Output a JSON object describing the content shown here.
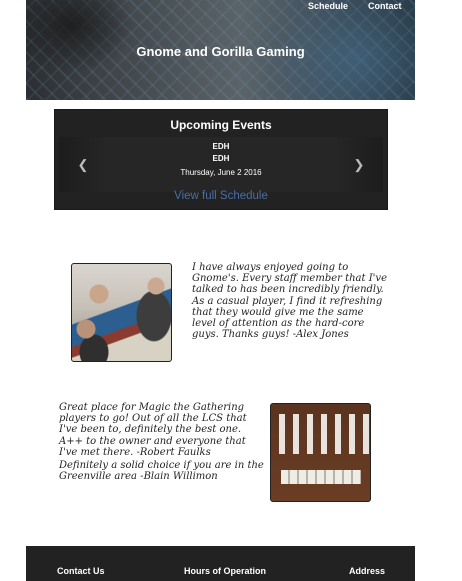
{
  "nav": {
    "schedule_label": "Schedule",
    "contact_label": "Contact"
  },
  "header": {
    "title": "Gnome and Gorilla Gaming"
  },
  "events": {
    "title": "Upcoming Events",
    "items": [
      "EDH",
      "EDH"
    ],
    "date": "Thursday, June 2 2016",
    "prev_icon": "chevron-left-icon",
    "next_icon": "chevron-right-icon",
    "view_schedule_label": "View full Schedule"
  },
  "testimonials": [
    {
      "text": "I have always enjoyed going to Gnome's. Every staff member that I've talked to has been incredibly friendly. As a casual player, I find it refreshing that they would give me the same level of attention as the hard-core guys. Thanks guys! -Alex Jones"
    },
    {
      "text": "Great place for Magic the Gathering players to go! Out of all the LCS that I've been to, definitely the best one. A++ to the owner and everyone that I've met there. -Robert Faulks"
    },
    {
      "text": "Definitely a solid choice if you are in the Greenville area -Blain Willimon"
    }
  ],
  "footer": {
    "contact_heading": "Contact Us",
    "hours_heading": "Hours of Operation",
    "address_heading": "Address"
  }
}
